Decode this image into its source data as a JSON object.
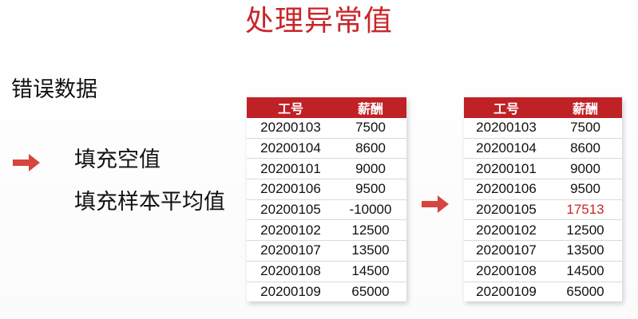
{
  "title": "处理异常值",
  "labels": {
    "error_data": "错误数据",
    "fill_empty": "填充空值",
    "fill_mean": "填充样本平均值"
  },
  "colors": {
    "accent": "#c8262b",
    "header_bg": "#bf2126",
    "header_text": "#ffffff"
  },
  "icons": {
    "left_arrow": "right-arrow-icon",
    "middle_arrow": "right-arrow-icon"
  },
  "table_before": {
    "headers": [
      "工号",
      "薪酬"
    ],
    "rows": [
      [
        "20200103",
        "7500"
      ],
      [
        "20200104",
        "8600"
      ],
      [
        "20200101",
        "9000"
      ],
      [
        "20200106",
        "9500"
      ],
      [
        "20200105",
        "-10000"
      ],
      [
        "20200102",
        "12500"
      ],
      [
        "20200107",
        "13500"
      ],
      [
        "20200108",
        "14500"
      ],
      [
        "20200109",
        "65000"
      ]
    ]
  },
  "table_after": {
    "headers": [
      "工号",
      "薪酬"
    ],
    "rows": [
      [
        "20200103",
        "7500"
      ],
      [
        "20200104",
        "8600"
      ],
      [
        "20200101",
        "9000"
      ],
      [
        "20200106",
        "9500"
      ],
      [
        "20200105",
        "17513"
      ],
      [
        "20200102",
        "12500"
      ],
      [
        "20200107",
        "13500"
      ],
      [
        "20200108",
        "14500"
      ],
      [
        "20200109",
        "65000"
      ]
    ],
    "highlight_row": 4
  }
}
